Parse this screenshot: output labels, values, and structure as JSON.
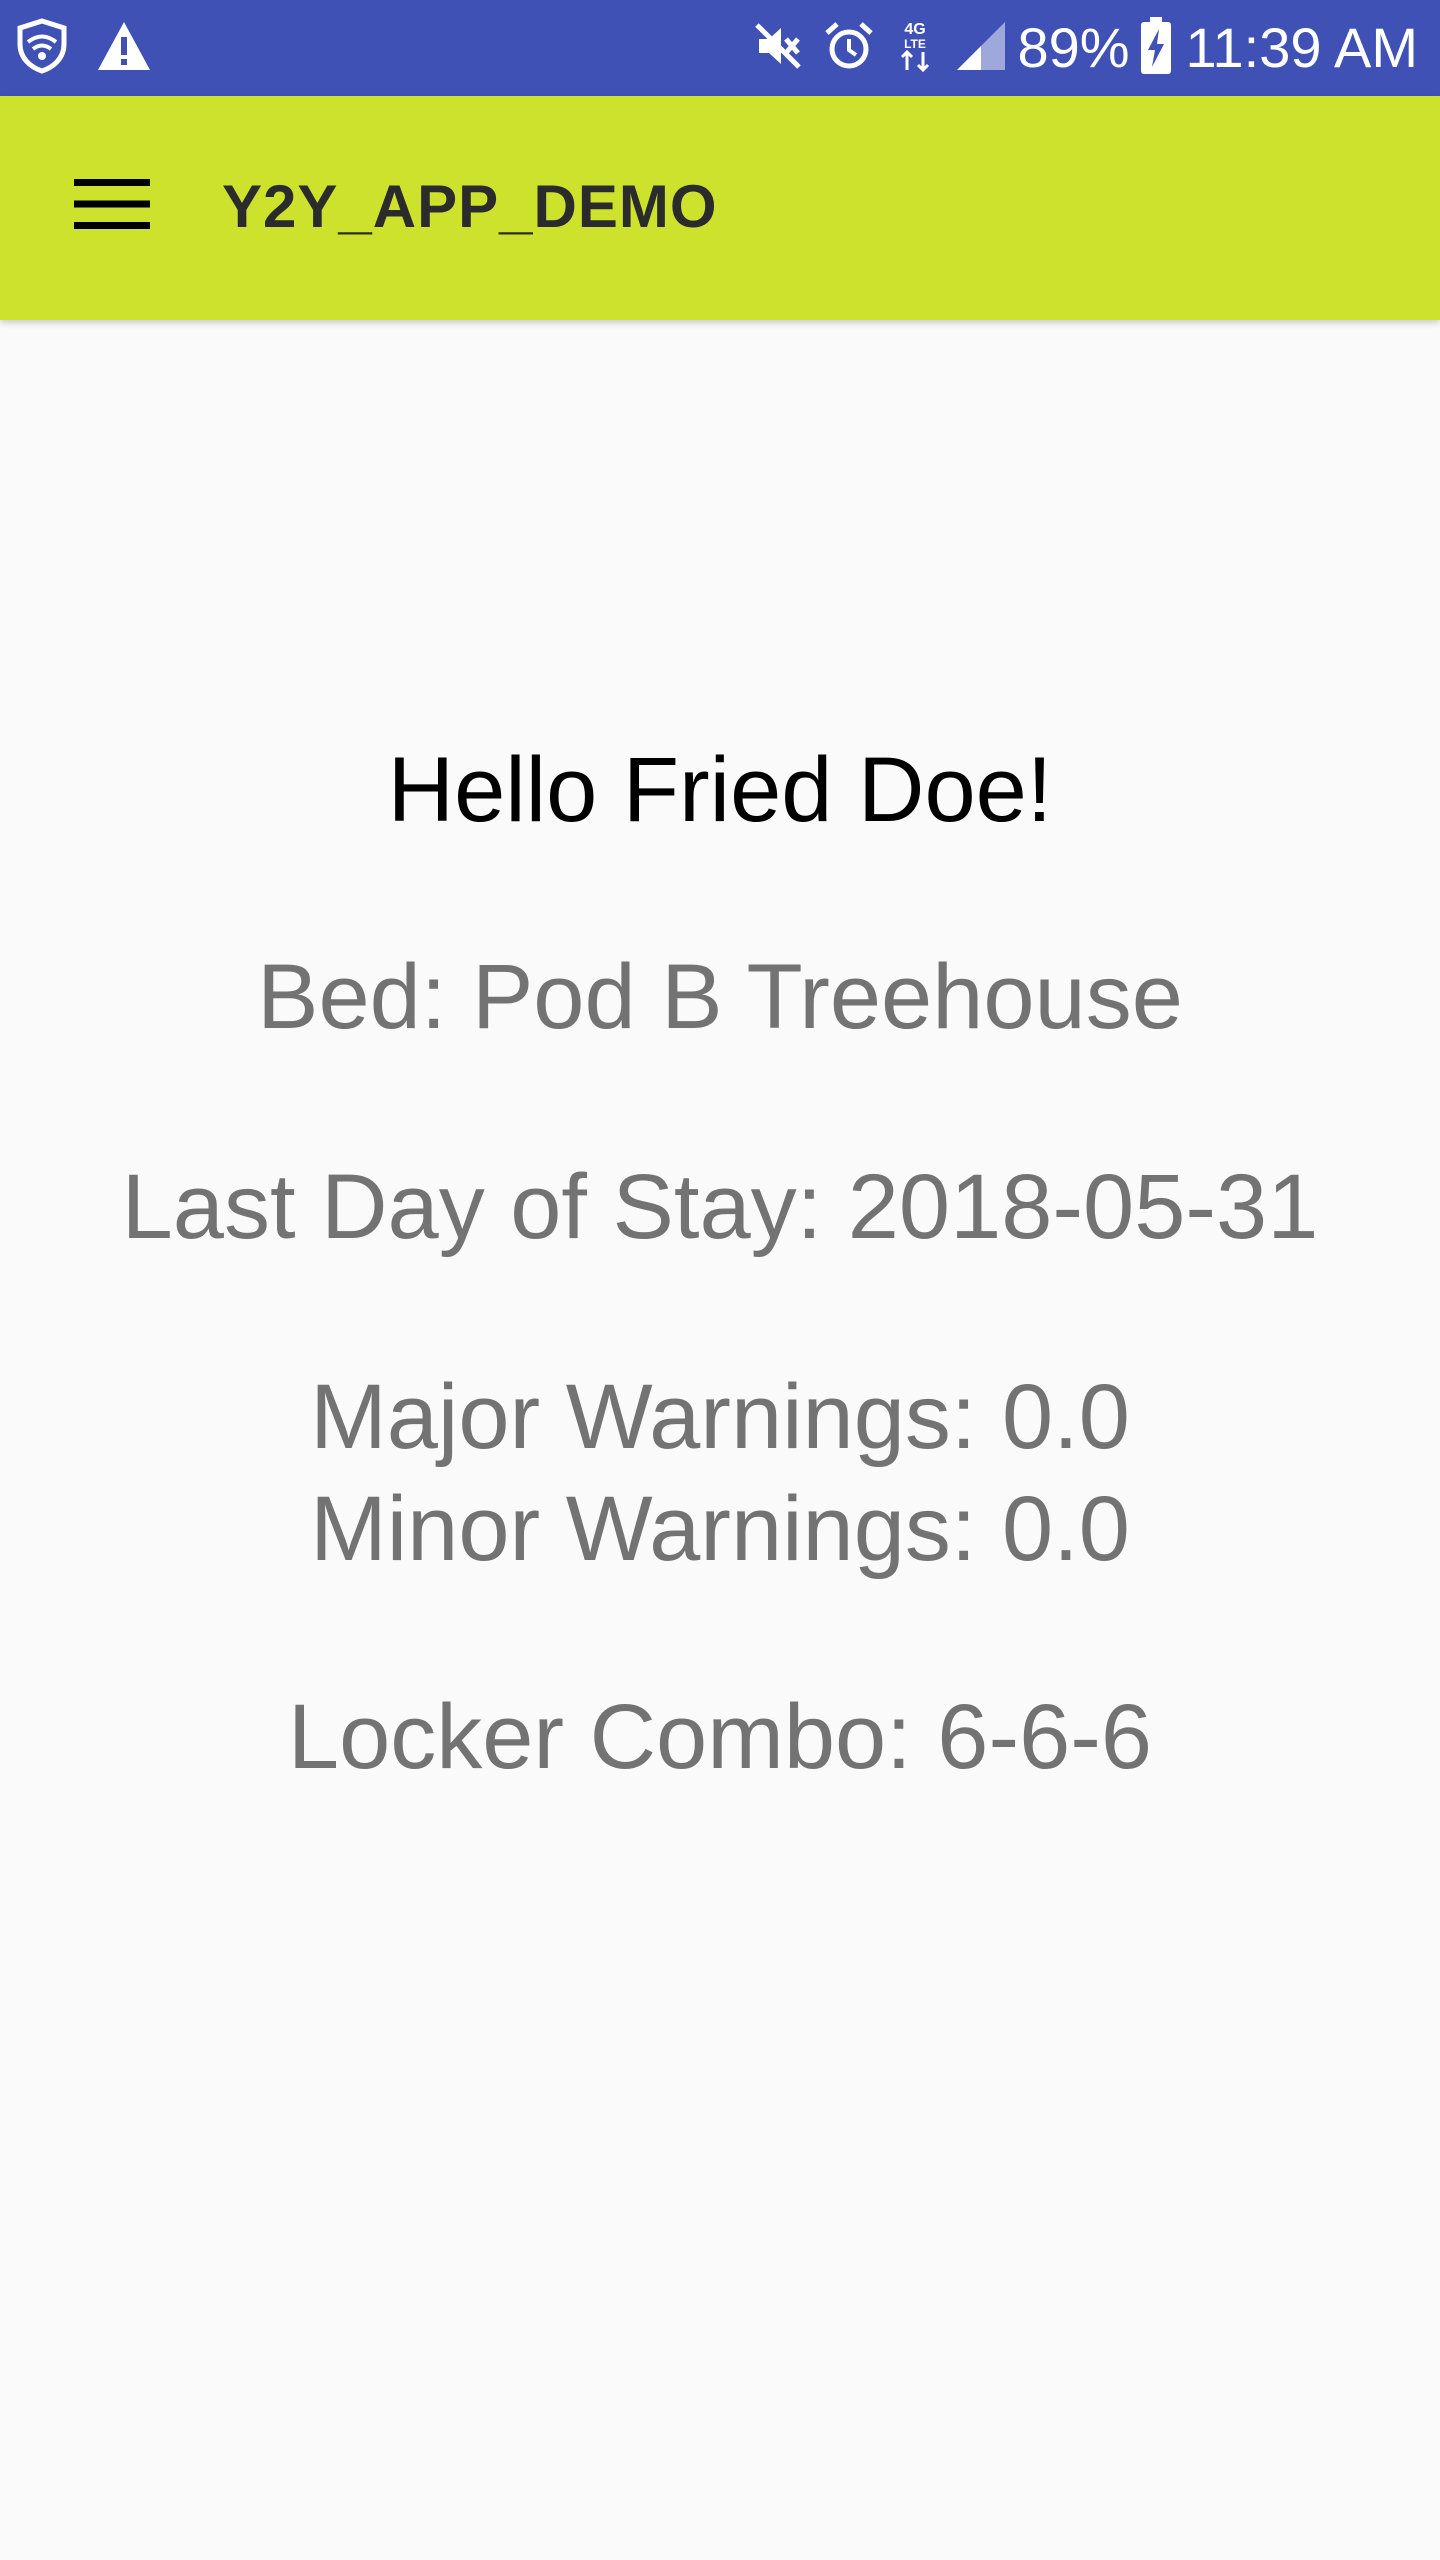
{
  "status_bar": {
    "background": "#3f51b5",
    "left_icons": [
      "shield-wifi-icon",
      "warning-icon"
    ],
    "right_icons": [
      "mute-icon",
      "alarm-icon",
      "4g-lte-data-icon",
      "signal-icon",
      "battery-charging-icon"
    ],
    "battery_percent": "89%",
    "time": "11:39 AM"
  },
  "app_bar": {
    "background": "#cde22d",
    "menu_icon": "hamburger-menu-icon",
    "title": "Y2Y_APP_DEMO"
  },
  "main": {
    "greeting": "Hello Fried Doe!",
    "bed": "Bed: Pod B Treehouse",
    "last_day": "Last Day of Stay: 2018-05-31",
    "major_warnings": "Major Warnings: 0.0",
    "minor_warnings": "Minor Warnings: 0.0",
    "locker_combo": "Locker Combo: 6-6-6"
  }
}
